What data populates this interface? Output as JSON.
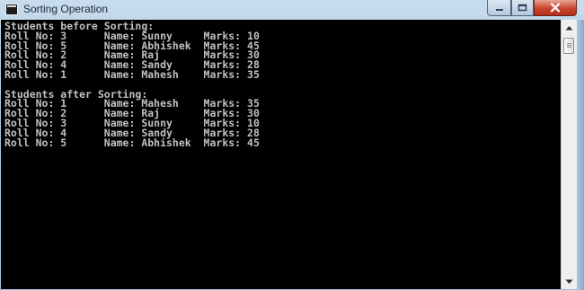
{
  "window": {
    "title": "Sorting Operation",
    "icon": "console-app-icon",
    "controls": {
      "minimize": "minimize-icon",
      "maximize": "maximize-icon",
      "close": "close-icon",
      "close_color": "#c8452d"
    }
  },
  "console": {
    "background": "#000000",
    "text_color": "#c0c0c0",
    "lines": [
      "Students before Sorting:",
      "Roll No: 3      Name: Sunny     Marks: 10",
      "Roll No: 5      Name: Abhishek  Marks: 45",
      "Roll No: 2      Name: Raj       Marks: 30",
      "Roll No: 4      Name: Sandy     Marks: 28",
      "Roll No: 1      Name: Mahesh    Marks: 35",
      "",
      "Students after Sorting:",
      "Roll No: 1      Name: Mahesh    Marks: 35",
      "Roll No: 2      Name: Raj       Marks: 30",
      "Roll No: 3      Name: Sunny     Marks: 10",
      "Roll No: 4      Name: Sandy     Marks: 28",
      "Roll No: 5      Name: Abhishek  Marks: 45"
    ]
  },
  "scrollbar": {
    "up": "scroll-up-arrow-icon",
    "down": "scroll-down-arrow-icon",
    "position": 0
  }
}
